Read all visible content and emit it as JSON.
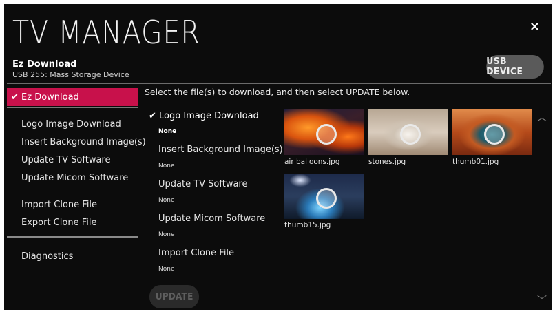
{
  "header": {
    "title": "TV MANAGER",
    "close_label": "×",
    "subtitle": "Ez Download",
    "device": "USB 255: Mass Storage Device",
    "usb_button": "USB DEVICE"
  },
  "nav": {
    "active": "✔ Ez Download",
    "items": [
      "Logo Image Download",
      "Insert Background Image(s)",
      "Update TV Software",
      "Update Micom Software",
      "Import Clone File",
      "Export Clone File",
      "Diagnostics"
    ]
  },
  "main": {
    "instruction": "Select the file(s) to download, and then select UPDATE below.",
    "options": [
      {
        "label": "✔ Logo Image Download",
        "value": "None"
      },
      {
        "label": "Insert Background Image(s)",
        "value": "None"
      },
      {
        "label": "Update TV Software",
        "value": "None"
      },
      {
        "label": "Update Micom Software",
        "value": "None"
      },
      {
        "label": "Import Clone File",
        "value": "None"
      }
    ],
    "files": [
      "air balloons.jpg",
      "stones.jpg",
      "thumb01.jpg",
      "thumb15.jpg"
    ],
    "update_button": "UPDATE",
    "scroll_up": "︿",
    "scroll_down": "﹀"
  },
  "colors": {
    "accent": "#c8114b",
    "background": "#0c0c0c"
  }
}
